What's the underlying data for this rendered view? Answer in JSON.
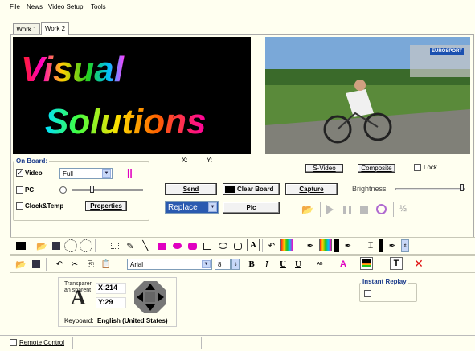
{
  "menu": [
    "File",
    "News",
    "Video Setup",
    "Tools"
  ],
  "tabs": [
    "Work 1",
    "Work 2"
  ],
  "logo": {
    "line1": "Visual",
    "line2": "Solutions"
  },
  "video_overlay": "EUROSPORT",
  "coords": {
    "x_label": "X:",
    "y_label": "Y:"
  },
  "on_board": {
    "title": "On Board:",
    "video_label": "Video",
    "pc_label": "PC",
    "clock_label": "Clock&Temp",
    "size_select": "Full",
    "properties_label": "Properties",
    "pause_symbol": "||"
  },
  "controls": {
    "send_label": "Send",
    "clear_board_label": "Clear Board",
    "capture_label": "Capture",
    "replace_select": "Replace",
    "pic_label": "Pic",
    "svideo_label": "S-Video",
    "composite_label": "Composite",
    "lock_label": "Lock",
    "brightness_label": "Brightness",
    "half_label": "½"
  },
  "font_toolbar": {
    "font_name": "Arial",
    "font_size": "8"
  },
  "position_panel": {
    "transparent_text": "Transparent an sparent",
    "big_letter": "A",
    "x_readout": "X:214",
    "y_readout": "Y:29",
    "keyboard_label": "Keyboard:",
    "keyboard_value": "English (United States)"
  },
  "instant_replay": {
    "label": "Instant Replay"
  },
  "status": {
    "remote_control_label": "Remote Control"
  },
  "colors": {
    "accent_blue": "#1a3a8a",
    "magenta": "#e000c0",
    "red_x": "#e01010"
  }
}
